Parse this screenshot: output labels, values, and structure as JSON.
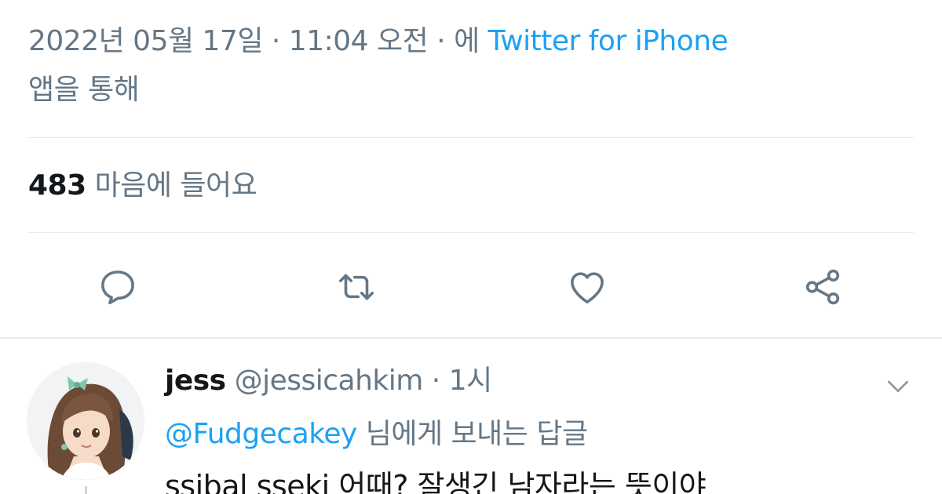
{
  "tweet_meta": {
    "timestamp": "2022년 05월 17일 · 11:04 오전 · 에",
    "source": "Twitter for iPhone",
    "via": "앱을 통해"
  },
  "engagement": {
    "likes_count": "483",
    "likes_label": "마음에 들어요"
  },
  "actions": {
    "reply_icon": "reply-icon",
    "retweet_icon": "retweet-icon",
    "like_icon": "heart-icon",
    "share_icon": "share-icon"
  },
  "reply": {
    "display_name": "jess",
    "handle": "@jessicahkim",
    "separator": "·",
    "time": "1시",
    "mention": "@Fudgecakey",
    "replying_suffix": "님에게 보내는 답글",
    "text": "ssibal sseki 어때? 잘생긴 남자라는 뜻이야"
  },
  "colors": {
    "link": "#1da1f2",
    "secondary_text": "#657786",
    "primary_text": "#14171a",
    "divider": "#e6ecf0"
  }
}
